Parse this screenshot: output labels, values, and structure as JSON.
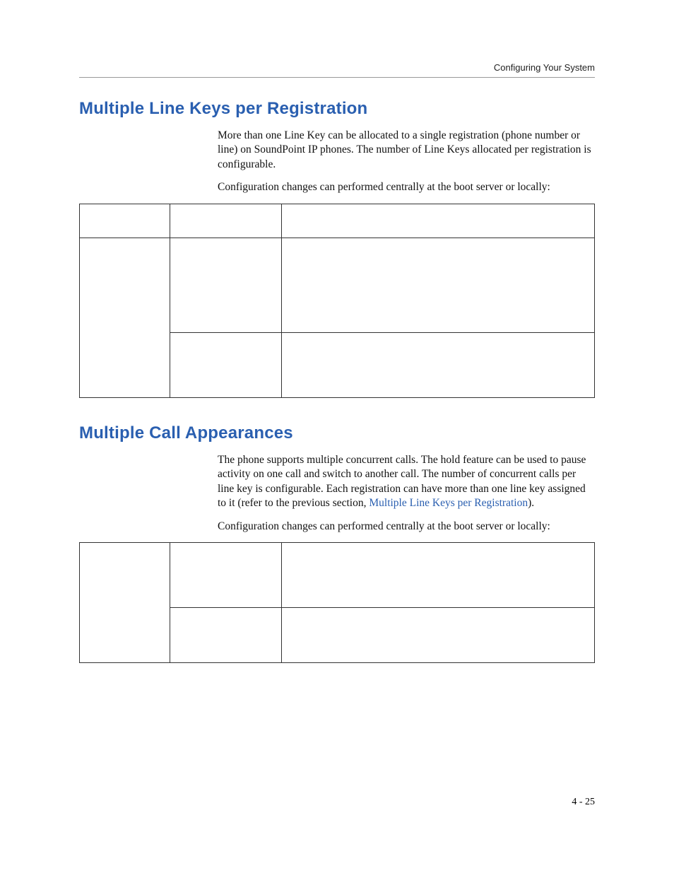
{
  "runningHead": "Configuring Your System",
  "section1": {
    "title": "Multiple Line Keys per Registration",
    "para1": "More than one Line Key can be allocated to a single registration (phone number or line) on SoundPoint IP phones. The number of Line Keys allocated per registration is configurable.",
    "para2": "Configuration changes can performed centrally at the boot server or locally:"
  },
  "section2": {
    "title": "Multiple Call Appearances",
    "para1_a": "The phone supports multiple concurrent calls. The hold feature can be used to pause activity on one call and switch to another call. The number of concurrent calls per line key is configurable. Each registration can have more than one line key assigned to it (refer to the previous section, ",
    "para1_link": "Multiple Line Keys per Registration",
    "para1_b": ").",
    "para2": "Configuration changes can performed centrally at the boot server or locally:"
  },
  "folio": "4 - 25"
}
